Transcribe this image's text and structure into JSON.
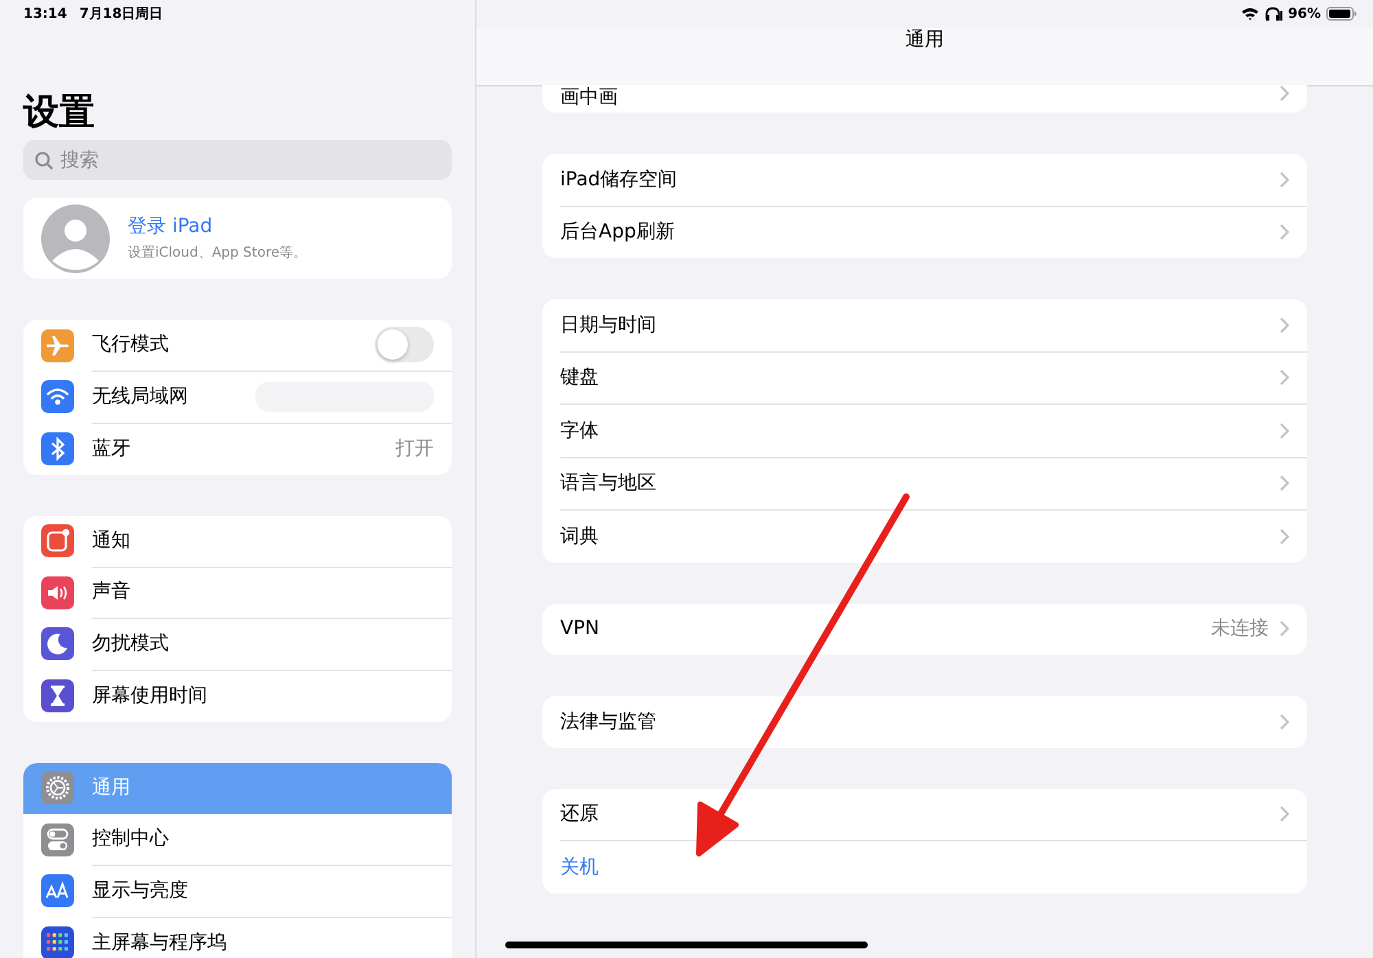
{
  "status_bar": {
    "time": "13:14",
    "date": "7月18日周日",
    "battery": "96%"
  },
  "sidebar": {
    "title": "设置",
    "search": {
      "placeholder": "搜索"
    },
    "profile": {
      "name": "登录 iPad",
      "subtitle": "设置iCloud、App Store等。"
    },
    "groups": [
      {
        "items": [
          {
            "label": "飞行模式",
            "kind": "toggle",
            "on": false,
            "color": "#f09a37",
            "selected": false
          },
          {
            "label": "无线局域网",
            "kind": "hidden",
            "color": "#3478f6",
            "selected": false
          },
          {
            "label": "蓝牙",
            "kind": "value",
            "value": "打开",
            "color": "#3478f6",
            "selected": false
          }
        ]
      },
      {
        "items": [
          {
            "label": "通知",
            "kind": "plain",
            "color": "#eb4e3d",
            "selected": false
          },
          {
            "label": "声音",
            "kind": "plain",
            "color": "#e9435a",
            "selected": false
          },
          {
            "label": "勿扰模式",
            "kind": "plain",
            "color": "#5856d6",
            "selected": false
          },
          {
            "label": "屏幕使用时间",
            "kind": "plain",
            "color": "#5a4fcf",
            "selected": false
          }
        ]
      },
      {
        "items": [
          {
            "label": "通用",
            "kind": "plain",
            "color": "#8e8e93",
            "selected": true
          },
          {
            "label": "控制中心",
            "kind": "plain",
            "color": "#8e8e93",
            "selected": false
          },
          {
            "label": "显示与亮度",
            "kind": "plain",
            "color": "#3478f6",
            "selected": false
          },
          {
            "label": "主屏幕与程序坞",
            "kind": "plain",
            "color": "#2b4fd8",
            "selected": false
          }
        ]
      }
    ]
  },
  "detail": {
    "title": "通用",
    "groups": [
      {
        "items": [
          {
            "label": "画中画",
            "kind": "link"
          }
        ]
      },
      {
        "items": [
          {
            "label": "iPad储存空间",
            "kind": "link"
          },
          {
            "label": "后台App刷新",
            "kind": "link"
          }
        ]
      },
      {
        "items": [
          {
            "label": "日期与时间",
            "kind": "link"
          },
          {
            "label": "键盘",
            "kind": "link"
          },
          {
            "label": "字体",
            "kind": "link"
          },
          {
            "label": "语言与地区",
            "kind": "link"
          },
          {
            "label": "词典",
            "kind": "link"
          }
        ]
      },
      {
        "items": [
          {
            "label": "VPN",
            "kind": "link",
            "value": "未连接"
          }
        ]
      },
      {
        "items": [
          {
            "label": "法律与监管",
            "kind": "link"
          }
        ]
      },
      {
        "items": [
          {
            "label": "还原",
            "kind": "link"
          },
          {
            "label": "关机",
            "kind": "action"
          }
        ]
      }
    ]
  }
}
